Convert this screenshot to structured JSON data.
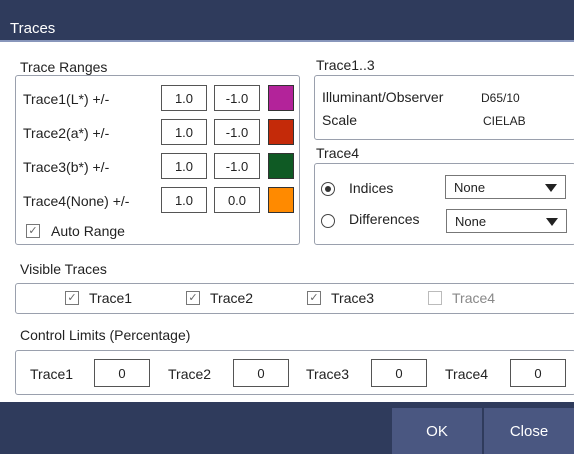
{
  "window": {
    "title": "Traces"
  },
  "trace_ranges": {
    "title": "Trace Ranges",
    "rows": [
      {
        "label": "Trace1(L*) +/-",
        "plus": "1.0",
        "minus": "-1.0",
        "color": "#b3239a"
      },
      {
        "label": "Trace2(a*) +/-",
        "plus": "1.0",
        "minus": "-1.0",
        "color": "#c42a09"
      },
      {
        "label": "Trace3(b*) +/-",
        "plus": "1.0",
        "minus": "-1.0",
        "color": "#0f5a24"
      },
      {
        "label": "Trace4(None) +/-",
        "plus": "1.0",
        "minus": "0.0",
        "color": "#ff8a00"
      }
    ],
    "auto_range": {
      "label": "Auto Range",
      "checked": true
    }
  },
  "trace13": {
    "title": "Trace1..3",
    "illuminant_label": "Illuminant/Observer",
    "illuminant_value": "D65/10",
    "scale_label": "Scale",
    "scale_value": "CIELAB"
  },
  "trace4": {
    "title": "Trace4",
    "indices": {
      "label": "Indices",
      "selected": true,
      "value": "None"
    },
    "differences": {
      "label": "Differences",
      "selected": false,
      "value": "None"
    }
  },
  "visible_traces": {
    "title": "Visible Traces",
    "items": [
      {
        "label": "Trace1",
        "checked": true
      },
      {
        "label": "Trace2",
        "checked": true
      },
      {
        "label": "Trace3",
        "checked": true
      },
      {
        "label": "Trace4",
        "checked": false
      }
    ]
  },
  "control_limits": {
    "title": "Control Limits (Percentage)",
    "items": [
      {
        "label": "Trace1",
        "value": "0"
      },
      {
        "label": "Trace2",
        "value": "0"
      },
      {
        "label": "Trace3",
        "value": "0"
      },
      {
        "label": "Trace4",
        "value": "0"
      }
    ]
  },
  "buttons": {
    "ok": "OK",
    "close": "Close"
  }
}
